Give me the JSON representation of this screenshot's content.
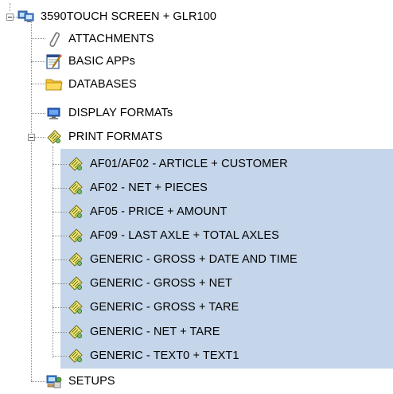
{
  "tree": {
    "root": {
      "label": "3590TOUCH SCREEN + GLR100",
      "icon": "computer-monitor-icon",
      "expanded": true
    },
    "children": [
      {
        "label": "ATTACHMENTS",
        "icon": "paperclip-icon"
      },
      {
        "label": "BASIC APPs",
        "icon": "notepad-pencil-icon"
      },
      {
        "label": "DATABASES",
        "icon": "folder-icon"
      },
      {
        "label": "DISPLAY FORMATs",
        "icon": "display-monitor-icon"
      },
      {
        "label": "PRINT FORMATS",
        "icon": "print-format-icon",
        "expanded": true,
        "children": [
          {
            "label": "AF01/AF02 - ARTICLE + CUSTOMER"
          },
          {
            "label": "AF02 - NET + PIECES"
          },
          {
            "label": "AF05 - PRICE + AMOUNT"
          },
          {
            "label": "AF09 - LAST AXLE + TOTAL AXLES"
          },
          {
            "label": "GENERIC - GROSS + DATE AND TIME"
          },
          {
            "label": "GENERIC - GROSS + NET"
          },
          {
            "label": "GENERIC - GROSS + TARE"
          },
          {
            "label": "GENERIC - NET + TARE"
          },
          {
            "label": "GENERIC - TEXT0 + TEXT1"
          }
        ]
      },
      {
        "label": "SETUPS",
        "icon": "setup-wizard-icon"
      }
    ]
  },
  "colors": {
    "selection": "#c5d6ea",
    "tree_lines": "#8a8a8a"
  }
}
